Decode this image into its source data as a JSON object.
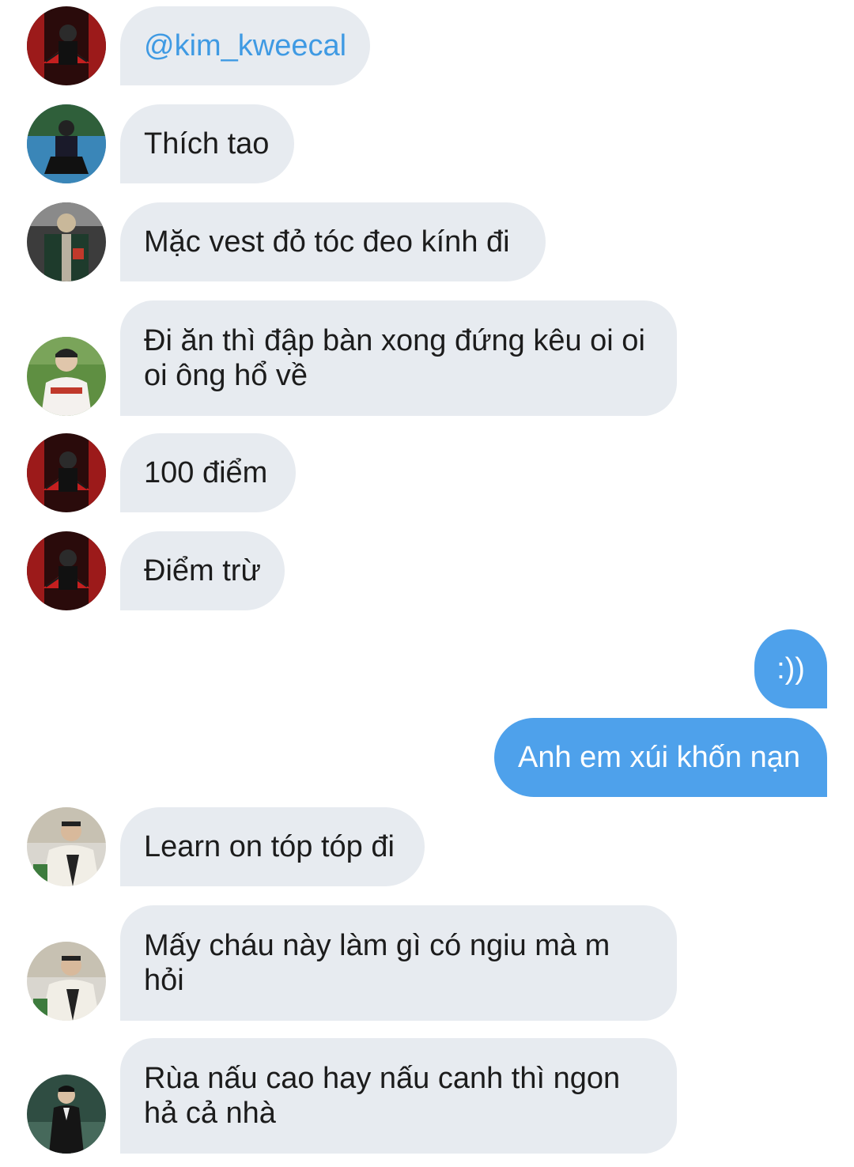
{
  "messages": [
    {
      "text": "@kim_kweecal",
      "avatar": "red-fan-avatar-icon"
    },
    {
      "text": "Thích tao",
      "avatar": "court-sitting-avatar-icon"
    },
    {
      "text": "Mặc vest đỏ tóc đeo kính đi",
      "avatar": "jersey-avatar-icon"
    },
    {
      "text": "Đi ăn thì đập bàn xong đứng kêu oi oi oi ông hổ về",
      "avatar": "landers-jersey-avatar-icon"
    },
    {
      "text": "100 điểm",
      "avatar": "red-fan-avatar-icon"
    },
    {
      "text": "Điểm trừ",
      "avatar": "red-fan-avatar-icon"
    },
    {
      "text": ":))",
      "avatar": null
    },
    {
      "text": "Anh em xúi khốn nạn",
      "avatar": null
    },
    {
      "text": "Learn on tóp tóp đi",
      "avatar": "fleece-jacket-avatar-icon"
    },
    {
      "text": "Mấy cháu này làm gì có ngiu mà m hỏi",
      "avatar": "fleece-jacket-avatar-icon"
    },
    {
      "text": "Rùa nấu cao hay nấu canh thì ngon hả cả nhà",
      "avatar": "dark-suit-avatar-icon"
    }
  ],
  "colors": {
    "incoming_bubble": "#e7ebf0",
    "outgoing_bubble": "#4ea1eb",
    "mention": "#3f9ae3"
  }
}
